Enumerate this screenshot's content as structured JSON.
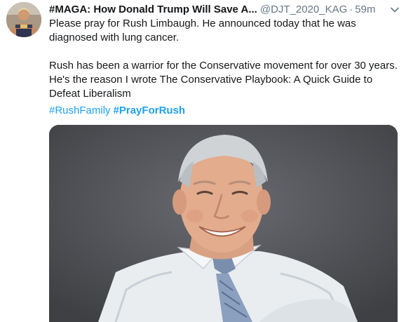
{
  "tweet": {
    "display_name": "#MAGA: How Donald Trump Will Save A...",
    "handle": "@DJT_2020_KAG",
    "separator": "·",
    "time": "59m",
    "paragraphs": [
      "Please pray for Rush Limbaugh. He announced today that he was diagnosed with lung cancer.",
      "Rush has been a warrior for the Conservative movement for over 30 years. He's the reason I wrote The Conservative Playbook: A Quick Guide to Defeat Liberalism"
    ],
    "hashtags": [
      {
        "text": "#RushFamily",
        "bold": false
      },
      {
        "text": "#PrayForRush",
        "bold": true
      }
    ]
  },
  "icons": {
    "menu": "chevron-down-icon"
  },
  "colors": {
    "text": "#14171a",
    "secondary": "#657786",
    "link": "#1da1f2",
    "photo_background": "#55565a"
  }
}
